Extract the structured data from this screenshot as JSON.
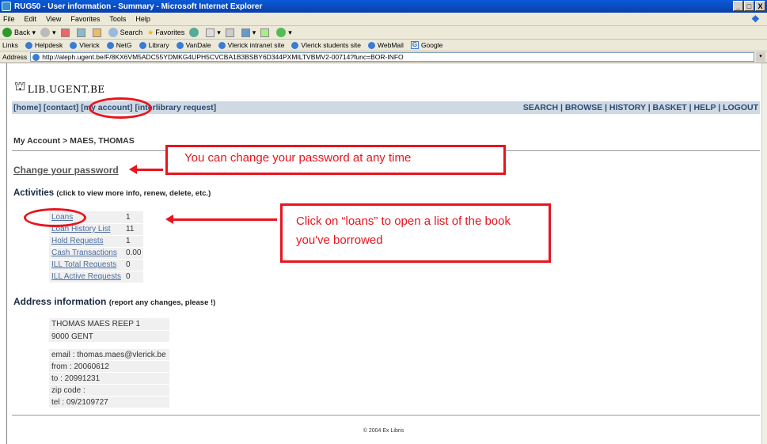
{
  "window": {
    "title": "RUG50 - User information - Summary - Microsoft Internet Explorer",
    "buttons": [
      "_",
      "□",
      "X"
    ]
  },
  "menubar": [
    "File",
    "Edit",
    "View",
    "Favorites",
    "Tools",
    "Help"
  ],
  "toolbar": {
    "back": "Back",
    "search": "Search",
    "favorites": "Favorites"
  },
  "linksbar": {
    "label": "Links",
    "links": [
      "Helpdesk",
      "Vlerick",
      "NetG",
      "Library",
      "VanDale",
      "Vlerick intranet site",
      "Vlerick students site",
      "WebMail",
      "Google"
    ]
  },
  "address": {
    "label": "Address",
    "url": "http://aleph.ugent.be/F/8KX6VM5ADC55YDMKG4UPH5CVCBA1B3BSBY6D344PXMILTVBMV2-00714?func=BOR-INFO"
  },
  "site": {
    "logo_text": "LIB.UGENT.BE",
    "nav_left": [
      "[home]",
      "[contact]",
      "[my account]",
      "[interlibrary request]"
    ],
    "nav_right": "SEARCH | BROWSE | HISTORY | BASKET | HELP | LOGOUT"
  },
  "breadcrumb": "My Account > MAES, THOMAS",
  "change_password": "Change your password",
  "activities": {
    "heading": "Activities",
    "hint": "(click to view more info, renew, delete, etc.)",
    "rows": [
      {
        "label": "Loans",
        "value": "1"
      },
      {
        "label": "Loan History List",
        "value": "11"
      },
      {
        "label": "Hold Requests",
        "value": "1"
      },
      {
        "label": "Cash Transactions",
        "value": "0.00"
      },
      {
        "label": "ILL Total Requests",
        "value": "0"
      },
      {
        "label": "ILL Active Requests",
        "value": "0"
      }
    ]
  },
  "address_info": {
    "heading": "Address information",
    "hint": "(report any changes, please !)",
    "name_line": "THOMAS MAES REEP 1",
    "city_line": "9000 GENT",
    "email": "email : thomas.maes@vlerick.be",
    "from": "from : 20060612",
    "to": "to : 20991231",
    "zip": "zip code :",
    "tel": "tel : 09/2109727"
  },
  "footer": "© 2004 Ex Libris",
  "annotations": {
    "password_note": "You can change your password at any time",
    "loans_note": "Click on “loans” to open a list of the book you've borrowed",
    "color": "#e8141e"
  }
}
